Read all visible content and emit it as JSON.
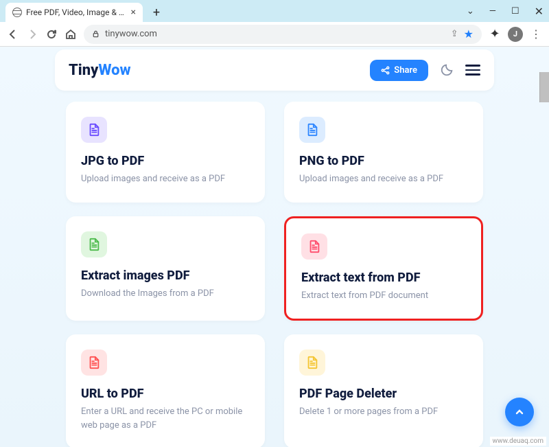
{
  "window": {
    "tab_title": "Free PDF, Video, Image & Other",
    "url": "tinywow.com",
    "avatar_initial": "J"
  },
  "header": {
    "logo_a": "Tiny",
    "logo_b": "Wow",
    "share": "Share"
  },
  "cards": [
    {
      "title": "JPG to PDF",
      "desc": "Upload images and receive as a PDF",
      "color": "purple"
    },
    {
      "title": "PNG to PDF",
      "desc": "Upload images and receive as a PDF",
      "color": "blue"
    },
    {
      "title": "Extract images PDF",
      "desc": "Download the Images from a PDF",
      "color": "green"
    },
    {
      "title": "Extract text from PDF",
      "desc": "Extract text from PDF document",
      "color": "pink",
      "highlight": true
    },
    {
      "title": "URL to PDF",
      "desc": "Enter a URL and receive the PC or mobile web page as a PDF",
      "color": "red"
    },
    {
      "title": "PDF Page Deleter",
      "desc": "Delete 1 or more pages from a PDF",
      "color": "yellow"
    }
  ],
  "watermark": "www.deuaq.com"
}
